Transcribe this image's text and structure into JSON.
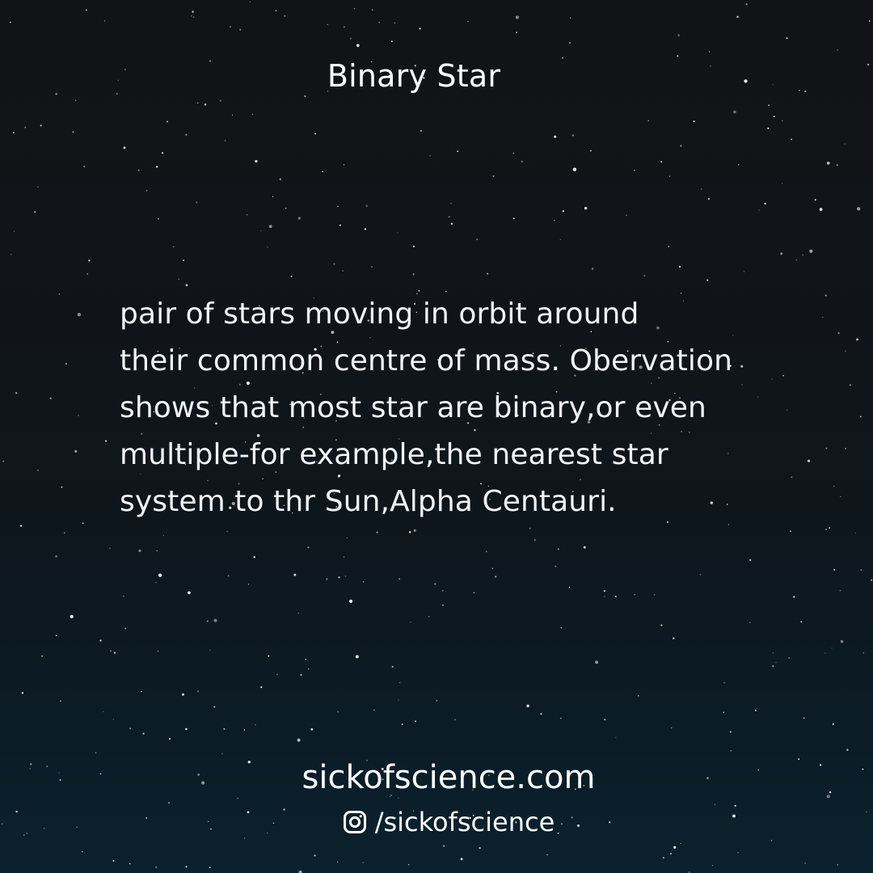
{
  "title": "Binary Star",
  "body_lines": [
    "pair of stars moving in orbit around",
    "their common centre of mass. Obervation",
    "shows that most star are binary,or even",
    "multiple-for example,the nearest star",
    "system to thr Sun,Alpha Centauri."
  ],
  "footer": {
    "website": "sickofscience.com",
    "social_icon": "instagram-icon",
    "social_handle": "/sickofscience"
  },
  "colors": {
    "background_top": "#121316",
    "background_bottom": "#0a222e",
    "text": "#ffffff"
  }
}
